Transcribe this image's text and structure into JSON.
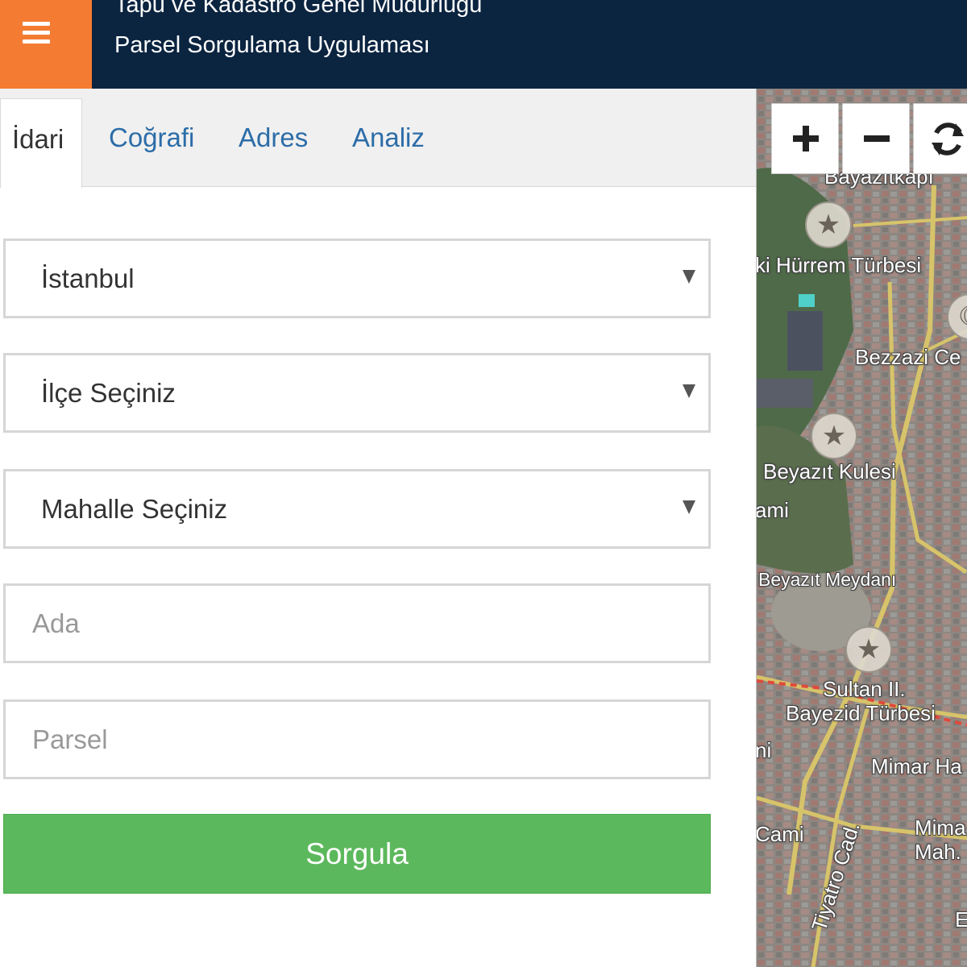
{
  "header": {
    "menu_icon": "hamburger-icon",
    "title": "Tapu ve Kadastro Genel Müdürlüğü",
    "subtitle": "Parsel Sorgulama Uygulaması",
    "colors": {
      "bar": "#0b2440",
      "menu_button": "#f47c32"
    }
  },
  "tabs": [
    {
      "label": "İdari",
      "active": true
    },
    {
      "label": "Coğrafi",
      "active": false
    },
    {
      "label": "Adres",
      "active": false
    },
    {
      "label": "Analiz",
      "active": false
    }
  ],
  "form": {
    "il": {
      "value": "İstanbul"
    },
    "ilce": {
      "value": "İlçe Seçiniz"
    },
    "mahalle": {
      "value": "Mahalle Seçiniz"
    },
    "ada": {
      "value": "",
      "placeholder": "Ada"
    },
    "parsel": {
      "value": "",
      "placeholder": "Parsel"
    },
    "submit_label": "Sorgula",
    "submit_color": "#5cb85c"
  },
  "map": {
    "controls": [
      {
        "icon": "zoom-in-icon"
      },
      {
        "icon": "zoom-out-icon"
      },
      {
        "icon": "refresh-icon"
      }
    ],
    "labels": {
      "bayazitkapi": "Bayazıtkapı",
      "hurrem": "ki Hürrem Türbesi",
      "bezzazi": "Bezzazi Ce",
      "beyazit_kulesi": "Beyazıt Kulesi",
      "ami": "ami",
      "beyazit_meydani": "Beyazıt Meydanı",
      "sultan_1": "Sultan II.",
      "sultan_2": "Bayezid Türbesi",
      "ni": "ni",
      "mimar_ha": "Mimar Ha",
      "cami": "Cami",
      "mima": "Mima",
      "mah": "Mah.",
      "tiyatro": "Tiyatro Cad.",
      "e": "E"
    }
  }
}
